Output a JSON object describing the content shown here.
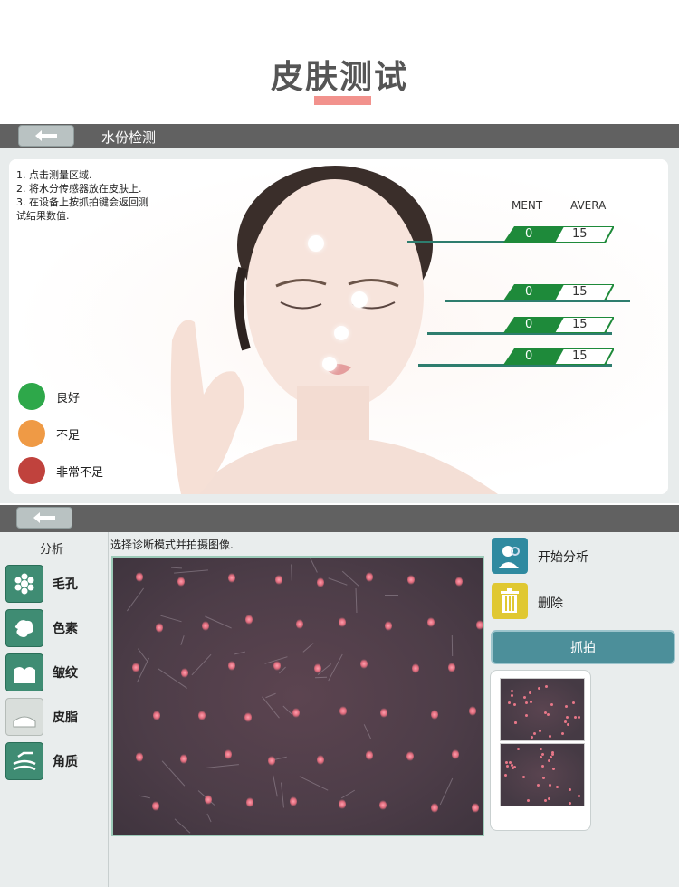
{
  "header": {
    "title": "皮肤测试"
  },
  "moisture_panel": {
    "title": "水份检测",
    "instructions": [
      "1. 点击测量区域.",
      "2. 将水分传感器放在皮肤上.",
      "3. 在设备上按抓拍键会返回测",
      "试结果数值."
    ],
    "columns": {
      "measurement": "MENT",
      "average": "AVERA"
    },
    "readings": [
      {
        "value": "0",
        "average": "15"
      },
      {
        "value": "0",
        "average": "15"
      },
      {
        "value": "0",
        "average": "15"
      },
      {
        "value": "0",
        "average": "15"
      }
    ],
    "legend": [
      {
        "label": "良好",
        "color": "#2ea84a"
      },
      {
        "label": "不足",
        "color": "#ef9a45"
      },
      {
        "label": "非常不足",
        "color": "#c0423d"
      }
    ]
  },
  "analysis_panel": {
    "sidebar_title": "分析",
    "tools": [
      {
        "label": "毛孔",
        "icon": "pores-icon"
      },
      {
        "label": "色素",
        "icon": "pigment-icon"
      },
      {
        "label": "皱纹",
        "icon": "wrinkle-icon"
      },
      {
        "label": "皮脂",
        "icon": "sebum-icon"
      },
      {
        "label": "角质",
        "icon": "keratin-icon"
      }
    ],
    "hint": "选择诊断模式并拍摄图像.",
    "actions": {
      "start_label": "开始分析",
      "delete_label": "删除",
      "capture_label": "抓拍"
    }
  },
  "colors": {
    "bar": "#616161",
    "accent_green": "#1e8a3a",
    "capture": "#4c8f9a"
  }
}
